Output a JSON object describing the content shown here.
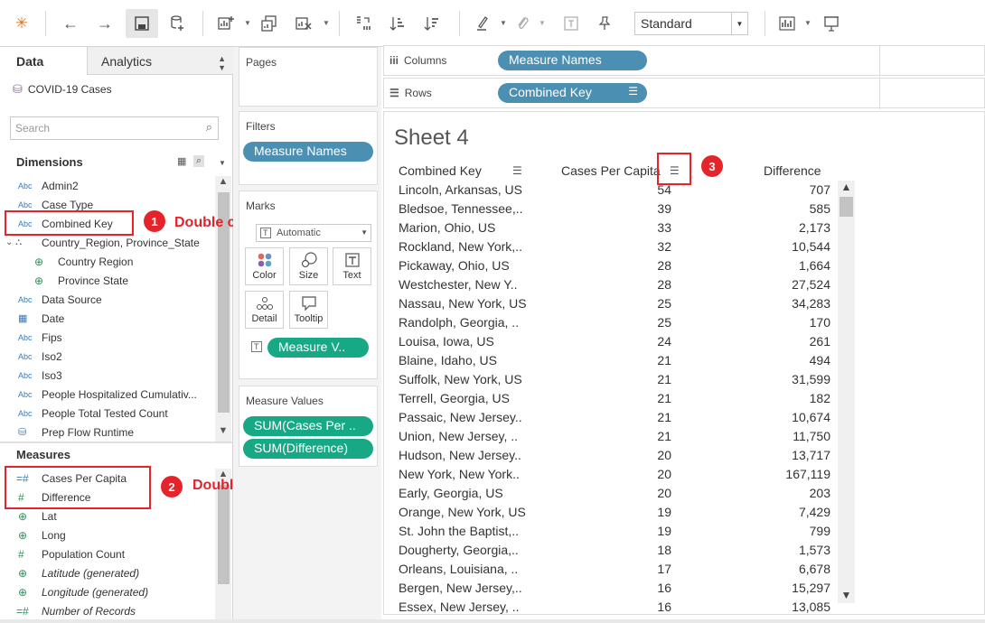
{
  "toolbar": {
    "mark_type_select": "Standard",
    "icons": [
      "tableau-logo-icon",
      "back-icon",
      "forward-icon",
      "save-icon",
      "new-datasource-icon",
      "new-worksheet-icon",
      "duplicate-sheet-icon",
      "clear-sheet-icon",
      "swap-axes-icon",
      "sort-ascending-icon",
      "sort-descending-icon",
      "highlight-icon",
      "group-icon",
      "show-labels-icon",
      "pin-icon",
      "show-me-icon",
      "presentation-icon"
    ]
  },
  "left": {
    "tab_data": "Data",
    "tab_analytics": "Analytics",
    "datasource": "COVID-19 Cases",
    "search_placeholder": "Search",
    "dimensions_title": "Dimensions",
    "measures_title": "Measures",
    "dimensions": [
      {
        "icon": "Abc",
        "label": "Admin2"
      },
      {
        "icon": "Abc",
        "label": "Case Type"
      },
      {
        "icon": "Abc",
        "label": "Combined Key"
      },
      {
        "icon": "⛬",
        "label": "Country_Region, Province_State"
      },
      {
        "icon": "⊕",
        "label": "Country Region"
      },
      {
        "icon": "⊕",
        "label": "Province State"
      },
      {
        "icon": "Abc",
        "label": "Data Source"
      },
      {
        "icon": "▦",
        "label": "Date"
      },
      {
        "icon": "Abc",
        "label": "Fips"
      },
      {
        "icon": "Abc",
        "label": "Iso2"
      },
      {
        "icon": "Abc",
        "label": "Iso3"
      },
      {
        "icon": "Abc",
        "label": "People Hospitalized Cumulativ..."
      },
      {
        "icon": "Abc",
        "label": "People Total Tested Count"
      },
      {
        "icon": "⛁",
        "label": "Prep Flow Runtime"
      }
    ],
    "measures": [
      {
        "icon": "=#",
        "label": "Cases Per Capita"
      },
      {
        "icon": "#",
        "label": "Difference"
      },
      {
        "icon": "⊕",
        "label": "Lat"
      },
      {
        "icon": "⊕",
        "label": "Long"
      },
      {
        "icon": "#",
        "label": "Population Count"
      },
      {
        "icon": "⊕",
        "label": "Latitude (generated)"
      },
      {
        "icon": "⊕",
        "label": "Longitude (generated)"
      },
      {
        "icon": "=#",
        "label": "Number of Records"
      }
    ]
  },
  "annotations": {
    "badge1": "1",
    "text1": "Double click",
    "badge2": "2",
    "text2": "Double click",
    "badge3": "3"
  },
  "cards": {
    "pages": "Pages",
    "filters": "Filters",
    "filter_pill": "Measure Names",
    "marks": "Marks",
    "marks_type": "Automatic",
    "color": "Color",
    "size": "Size",
    "text": "Text",
    "detail": "Detail",
    "tooltip": "Tooltip",
    "marks_pill": "Measure V..",
    "measure_values": "Measure Values",
    "mv_pill1": "SUM(Cases Per ..",
    "mv_pill2": "SUM(Difference)"
  },
  "shelves": {
    "columns_label": "Columns",
    "columns_pill": "Measure Names",
    "rows_label": "Rows",
    "rows_pill": "Combined Key"
  },
  "view": {
    "sheet_title": "Sheet 4",
    "headers": [
      "Combined Key",
      "Cases Per Capita",
      "Difference"
    ],
    "rows": [
      [
        "Lincoln, Arkansas, US",
        "54",
        "707"
      ],
      [
        "Bledsoe, Tennessee,..",
        "39",
        "585"
      ],
      [
        "Marion, Ohio, US",
        "33",
        "2,173"
      ],
      [
        "Rockland, New York,..",
        "32",
        "10,544"
      ],
      [
        "Pickaway, Ohio, US",
        "28",
        "1,664"
      ],
      [
        "Westchester, New Y..",
        "28",
        "27,524"
      ],
      [
        "Nassau, New York, US",
        "25",
        "34,283"
      ],
      [
        "Randolph, Georgia, ..",
        "25",
        "170"
      ],
      [
        "Louisa, Iowa, US",
        "24",
        "261"
      ],
      [
        "Blaine, Idaho, US",
        "21",
        "494"
      ],
      [
        "Suffolk, New York, US",
        "21",
        "31,599"
      ],
      [
        "Terrell, Georgia, US",
        "21",
        "182"
      ],
      [
        "Passaic, New Jersey..",
        "21",
        "10,674"
      ],
      [
        "Union, New Jersey, ..",
        "21",
        "11,750"
      ],
      [
        "Hudson, New Jersey..",
        "20",
        "13,717"
      ],
      [
        "New York, New York..",
        "20",
        "167,119"
      ],
      [
        "Early, Georgia, US",
        "20",
        "203"
      ],
      [
        "Orange, New York, US",
        "19",
        "7,429"
      ],
      [
        "St. John the Baptist,..",
        "19",
        "799"
      ],
      [
        "Dougherty, Georgia,..",
        "18",
        "1,573"
      ],
      [
        "Orleans, Louisiana, ..",
        "17",
        "6,678"
      ],
      [
        "Bergen, New Jersey,..",
        "16",
        "15,297"
      ],
      [
        "Essex, New Jersey, ..",
        "16",
        "13,085"
      ]
    ]
  }
}
